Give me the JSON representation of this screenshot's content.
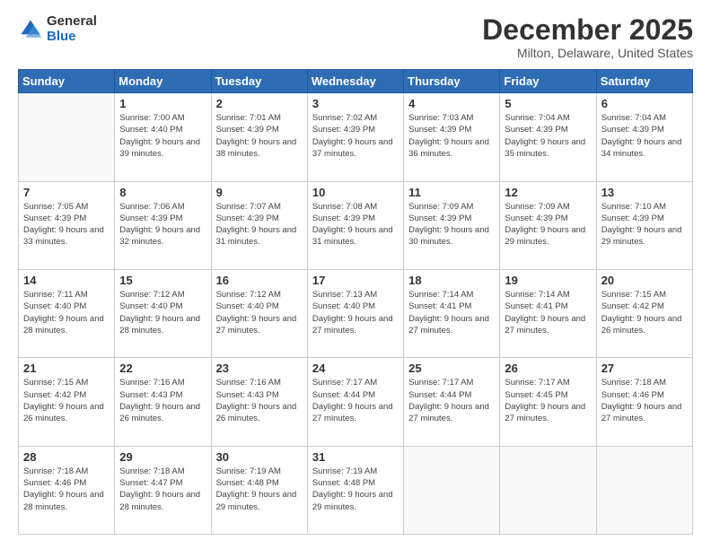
{
  "logo": {
    "general": "General",
    "blue": "Blue"
  },
  "header": {
    "month": "December 2025",
    "location": "Milton, Delaware, United States"
  },
  "weekdays": [
    "Sunday",
    "Monday",
    "Tuesday",
    "Wednesday",
    "Thursday",
    "Friday",
    "Saturday"
  ],
  "weeks": [
    [
      {
        "day": "",
        "sunrise": "",
        "sunset": "",
        "daylight": ""
      },
      {
        "day": "1",
        "sunrise": "7:00 AM",
        "sunset": "4:40 PM",
        "daylight": "9 hours and 39 minutes."
      },
      {
        "day": "2",
        "sunrise": "7:01 AM",
        "sunset": "4:39 PM",
        "daylight": "9 hours and 38 minutes."
      },
      {
        "day": "3",
        "sunrise": "7:02 AM",
        "sunset": "4:39 PM",
        "daylight": "9 hours and 37 minutes."
      },
      {
        "day": "4",
        "sunrise": "7:03 AM",
        "sunset": "4:39 PM",
        "daylight": "9 hours and 36 minutes."
      },
      {
        "day": "5",
        "sunrise": "7:04 AM",
        "sunset": "4:39 PM",
        "daylight": "9 hours and 35 minutes."
      },
      {
        "day": "6",
        "sunrise": "7:04 AM",
        "sunset": "4:39 PM",
        "daylight": "9 hours and 34 minutes."
      }
    ],
    [
      {
        "day": "7",
        "sunrise": "7:05 AM",
        "sunset": "4:39 PM",
        "daylight": "9 hours and 33 minutes."
      },
      {
        "day": "8",
        "sunrise": "7:06 AM",
        "sunset": "4:39 PM",
        "daylight": "9 hours and 32 minutes."
      },
      {
        "day": "9",
        "sunrise": "7:07 AM",
        "sunset": "4:39 PM",
        "daylight": "9 hours and 31 minutes."
      },
      {
        "day": "10",
        "sunrise": "7:08 AM",
        "sunset": "4:39 PM",
        "daylight": "9 hours and 31 minutes."
      },
      {
        "day": "11",
        "sunrise": "7:09 AM",
        "sunset": "4:39 PM",
        "daylight": "9 hours and 30 minutes."
      },
      {
        "day": "12",
        "sunrise": "7:09 AM",
        "sunset": "4:39 PM",
        "daylight": "9 hours and 29 minutes."
      },
      {
        "day": "13",
        "sunrise": "7:10 AM",
        "sunset": "4:39 PM",
        "daylight": "9 hours and 29 minutes."
      }
    ],
    [
      {
        "day": "14",
        "sunrise": "7:11 AM",
        "sunset": "4:40 PM",
        "daylight": "9 hours and 28 minutes."
      },
      {
        "day": "15",
        "sunrise": "7:12 AM",
        "sunset": "4:40 PM",
        "daylight": "9 hours and 28 minutes."
      },
      {
        "day": "16",
        "sunrise": "7:12 AM",
        "sunset": "4:40 PM",
        "daylight": "9 hours and 27 minutes."
      },
      {
        "day": "17",
        "sunrise": "7:13 AM",
        "sunset": "4:40 PM",
        "daylight": "9 hours and 27 minutes."
      },
      {
        "day": "18",
        "sunrise": "7:14 AM",
        "sunset": "4:41 PM",
        "daylight": "9 hours and 27 minutes."
      },
      {
        "day": "19",
        "sunrise": "7:14 AM",
        "sunset": "4:41 PM",
        "daylight": "9 hours and 27 minutes."
      },
      {
        "day": "20",
        "sunrise": "7:15 AM",
        "sunset": "4:42 PM",
        "daylight": "9 hours and 26 minutes."
      }
    ],
    [
      {
        "day": "21",
        "sunrise": "7:15 AM",
        "sunset": "4:42 PM",
        "daylight": "9 hours and 26 minutes."
      },
      {
        "day": "22",
        "sunrise": "7:16 AM",
        "sunset": "4:43 PM",
        "daylight": "9 hours and 26 minutes."
      },
      {
        "day": "23",
        "sunrise": "7:16 AM",
        "sunset": "4:43 PM",
        "daylight": "9 hours and 26 minutes."
      },
      {
        "day": "24",
        "sunrise": "7:17 AM",
        "sunset": "4:44 PM",
        "daylight": "9 hours and 27 minutes."
      },
      {
        "day": "25",
        "sunrise": "7:17 AM",
        "sunset": "4:44 PM",
        "daylight": "9 hours and 27 minutes."
      },
      {
        "day": "26",
        "sunrise": "7:17 AM",
        "sunset": "4:45 PM",
        "daylight": "9 hours and 27 minutes."
      },
      {
        "day": "27",
        "sunrise": "7:18 AM",
        "sunset": "4:46 PM",
        "daylight": "9 hours and 27 minutes."
      }
    ],
    [
      {
        "day": "28",
        "sunrise": "7:18 AM",
        "sunset": "4:46 PM",
        "daylight": "9 hours and 28 minutes."
      },
      {
        "day": "29",
        "sunrise": "7:18 AM",
        "sunset": "4:47 PM",
        "daylight": "9 hours and 28 minutes."
      },
      {
        "day": "30",
        "sunrise": "7:19 AM",
        "sunset": "4:48 PM",
        "daylight": "9 hours and 29 minutes."
      },
      {
        "day": "31",
        "sunrise": "7:19 AM",
        "sunset": "4:48 PM",
        "daylight": "9 hours and 29 minutes."
      },
      {
        "day": "",
        "sunrise": "",
        "sunset": "",
        "daylight": ""
      },
      {
        "day": "",
        "sunrise": "",
        "sunset": "",
        "daylight": ""
      },
      {
        "day": "",
        "sunrise": "",
        "sunset": "",
        "daylight": ""
      }
    ]
  ]
}
